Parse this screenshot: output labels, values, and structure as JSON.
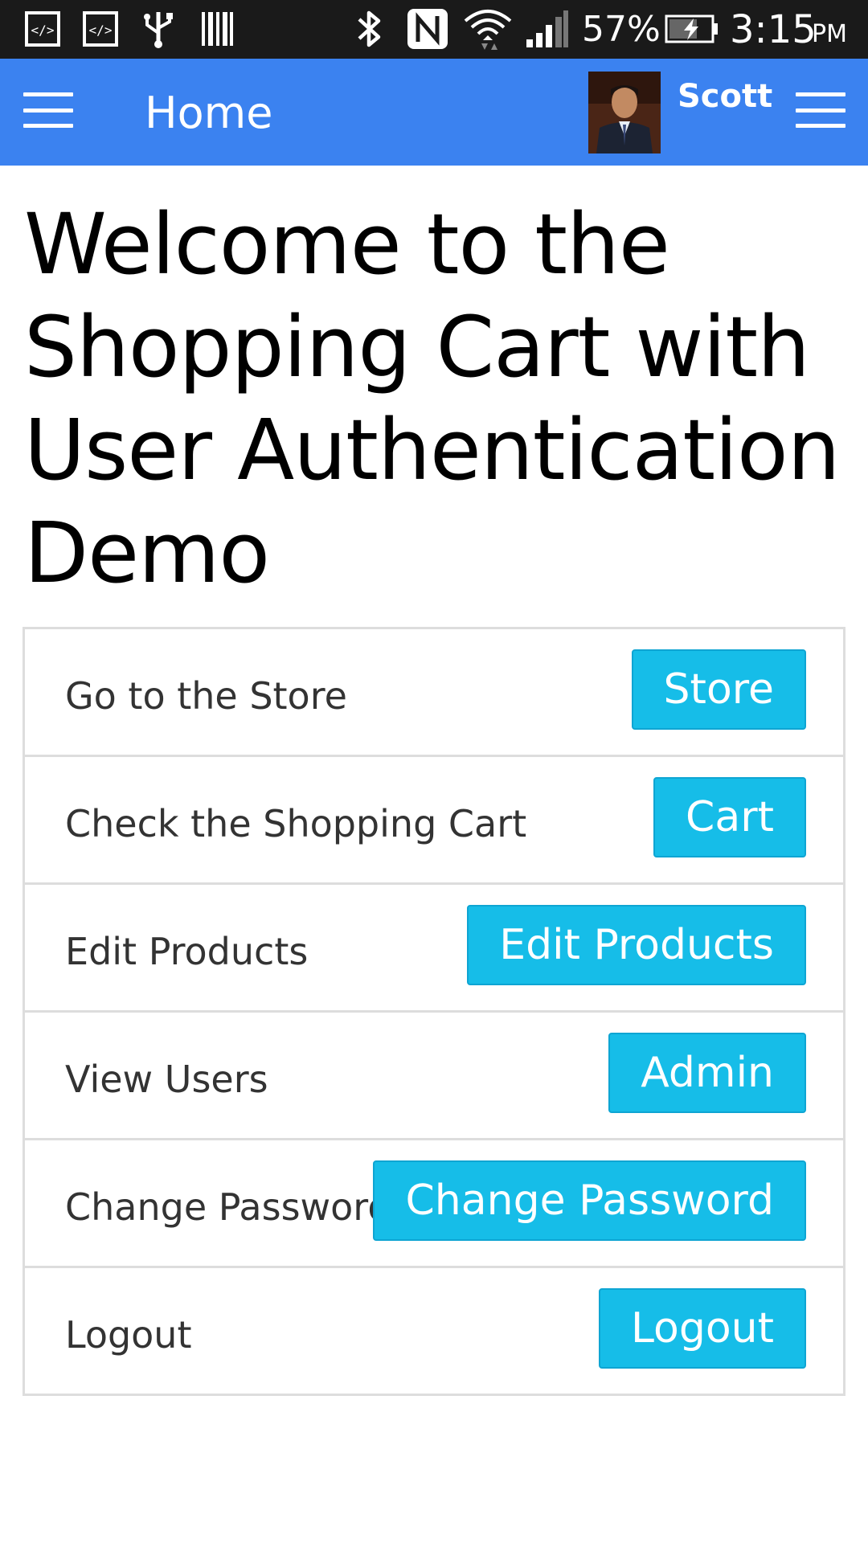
{
  "status_bar": {
    "battery": "57%",
    "time": "3:15",
    "ampm": "PM",
    "icons": [
      "code-icon",
      "code-icon",
      "usb-icon",
      "barcode-icon",
      "bluetooth-icon",
      "nfc-icon",
      "wifi-icon",
      "signal-icon",
      "battery-charging-icon"
    ]
  },
  "app_bar": {
    "title": "Home",
    "user_name": "Scott",
    "color": "#3b82f0"
  },
  "page": {
    "title": "Welcome to the Shopping Cart with User Authentication Demo"
  },
  "menu": {
    "button_color": "#16bde8",
    "items": [
      {
        "label": "Go to the Store",
        "button": "Store"
      },
      {
        "label": "Check the Shopping Cart",
        "button": "Cart"
      },
      {
        "label": "Edit Products",
        "button": "Edit Products"
      },
      {
        "label": "View Users",
        "button": "Admin"
      },
      {
        "label": "Change Password",
        "button": "Change Password"
      },
      {
        "label": "Logout",
        "button": "Logout"
      }
    ]
  }
}
